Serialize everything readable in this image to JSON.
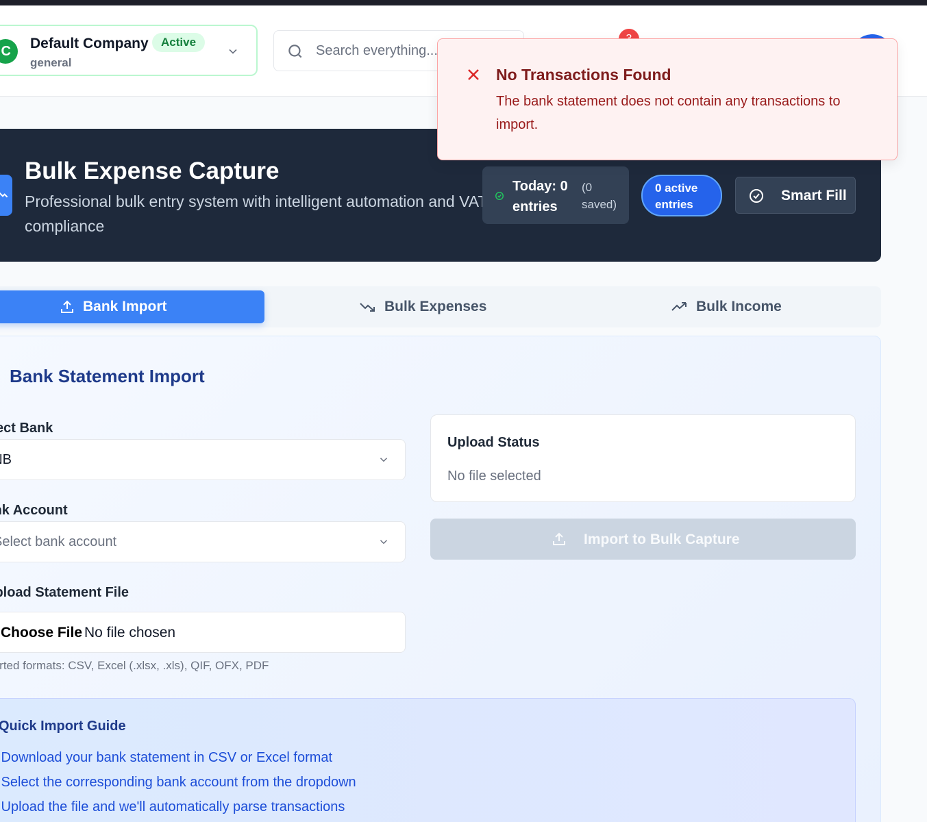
{
  "header": {
    "company": {
      "initial": "C",
      "name": "Default Company",
      "type": "general",
      "status_badge": "Active"
    },
    "search": {
      "placeholder": "Search everything..."
    },
    "notifications": {
      "count": "3"
    }
  },
  "toast": {
    "title": "No Transactions Found",
    "message": "The bank statement does not contain any transactions to import."
  },
  "hero": {
    "title": "Bulk Expense Capture",
    "subtitle": "Professional bulk entry system with intelligent automation and VAT compliance",
    "today_label": "Today: 0 entries",
    "today_saved": "(0 saved)",
    "active_entries": "0 active entries",
    "smart_fill_label": "Smart Fill"
  },
  "tabs": [
    {
      "label": "Bank Import",
      "icon": "upload-icon",
      "active": true
    },
    {
      "label": "Bulk Expenses",
      "icon": "trending-down-icon",
      "active": false
    },
    {
      "label": "Bulk Income",
      "icon": "trending-up-icon",
      "active": false
    }
  ],
  "bank_import": {
    "title": "Bank Statement Import",
    "select_bank": {
      "label": "Select Bank",
      "value": "FNB"
    },
    "bank_account": {
      "label": "Bank Account",
      "placeholder": "Select bank account"
    },
    "upload_file": {
      "label": "Upload Statement File",
      "button": "Choose File",
      "status": "No file chosen",
      "hint": "Supported formats: CSV, Excel (.xlsx, .xls), QIF, OFX, PDF"
    },
    "upload_status": {
      "title": "Upload Status",
      "value": "No file selected"
    },
    "import_button": "Import to Bulk Capture",
    "guide": {
      "title": "Quick Import Guide",
      "items": [
        "• Download your bank statement in CSV or Excel format",
        "• Select the corresponding bank account from the dropdown",
        "• Upload the file and we'll automatically parse transactions"
      ]
    }
  },
  "colors": {
    "accent": "#3b82f6",
    "hero_bg": "#1e293b",
    "error": "#dc2626",
    "success": "#16a34a"
  }
}
